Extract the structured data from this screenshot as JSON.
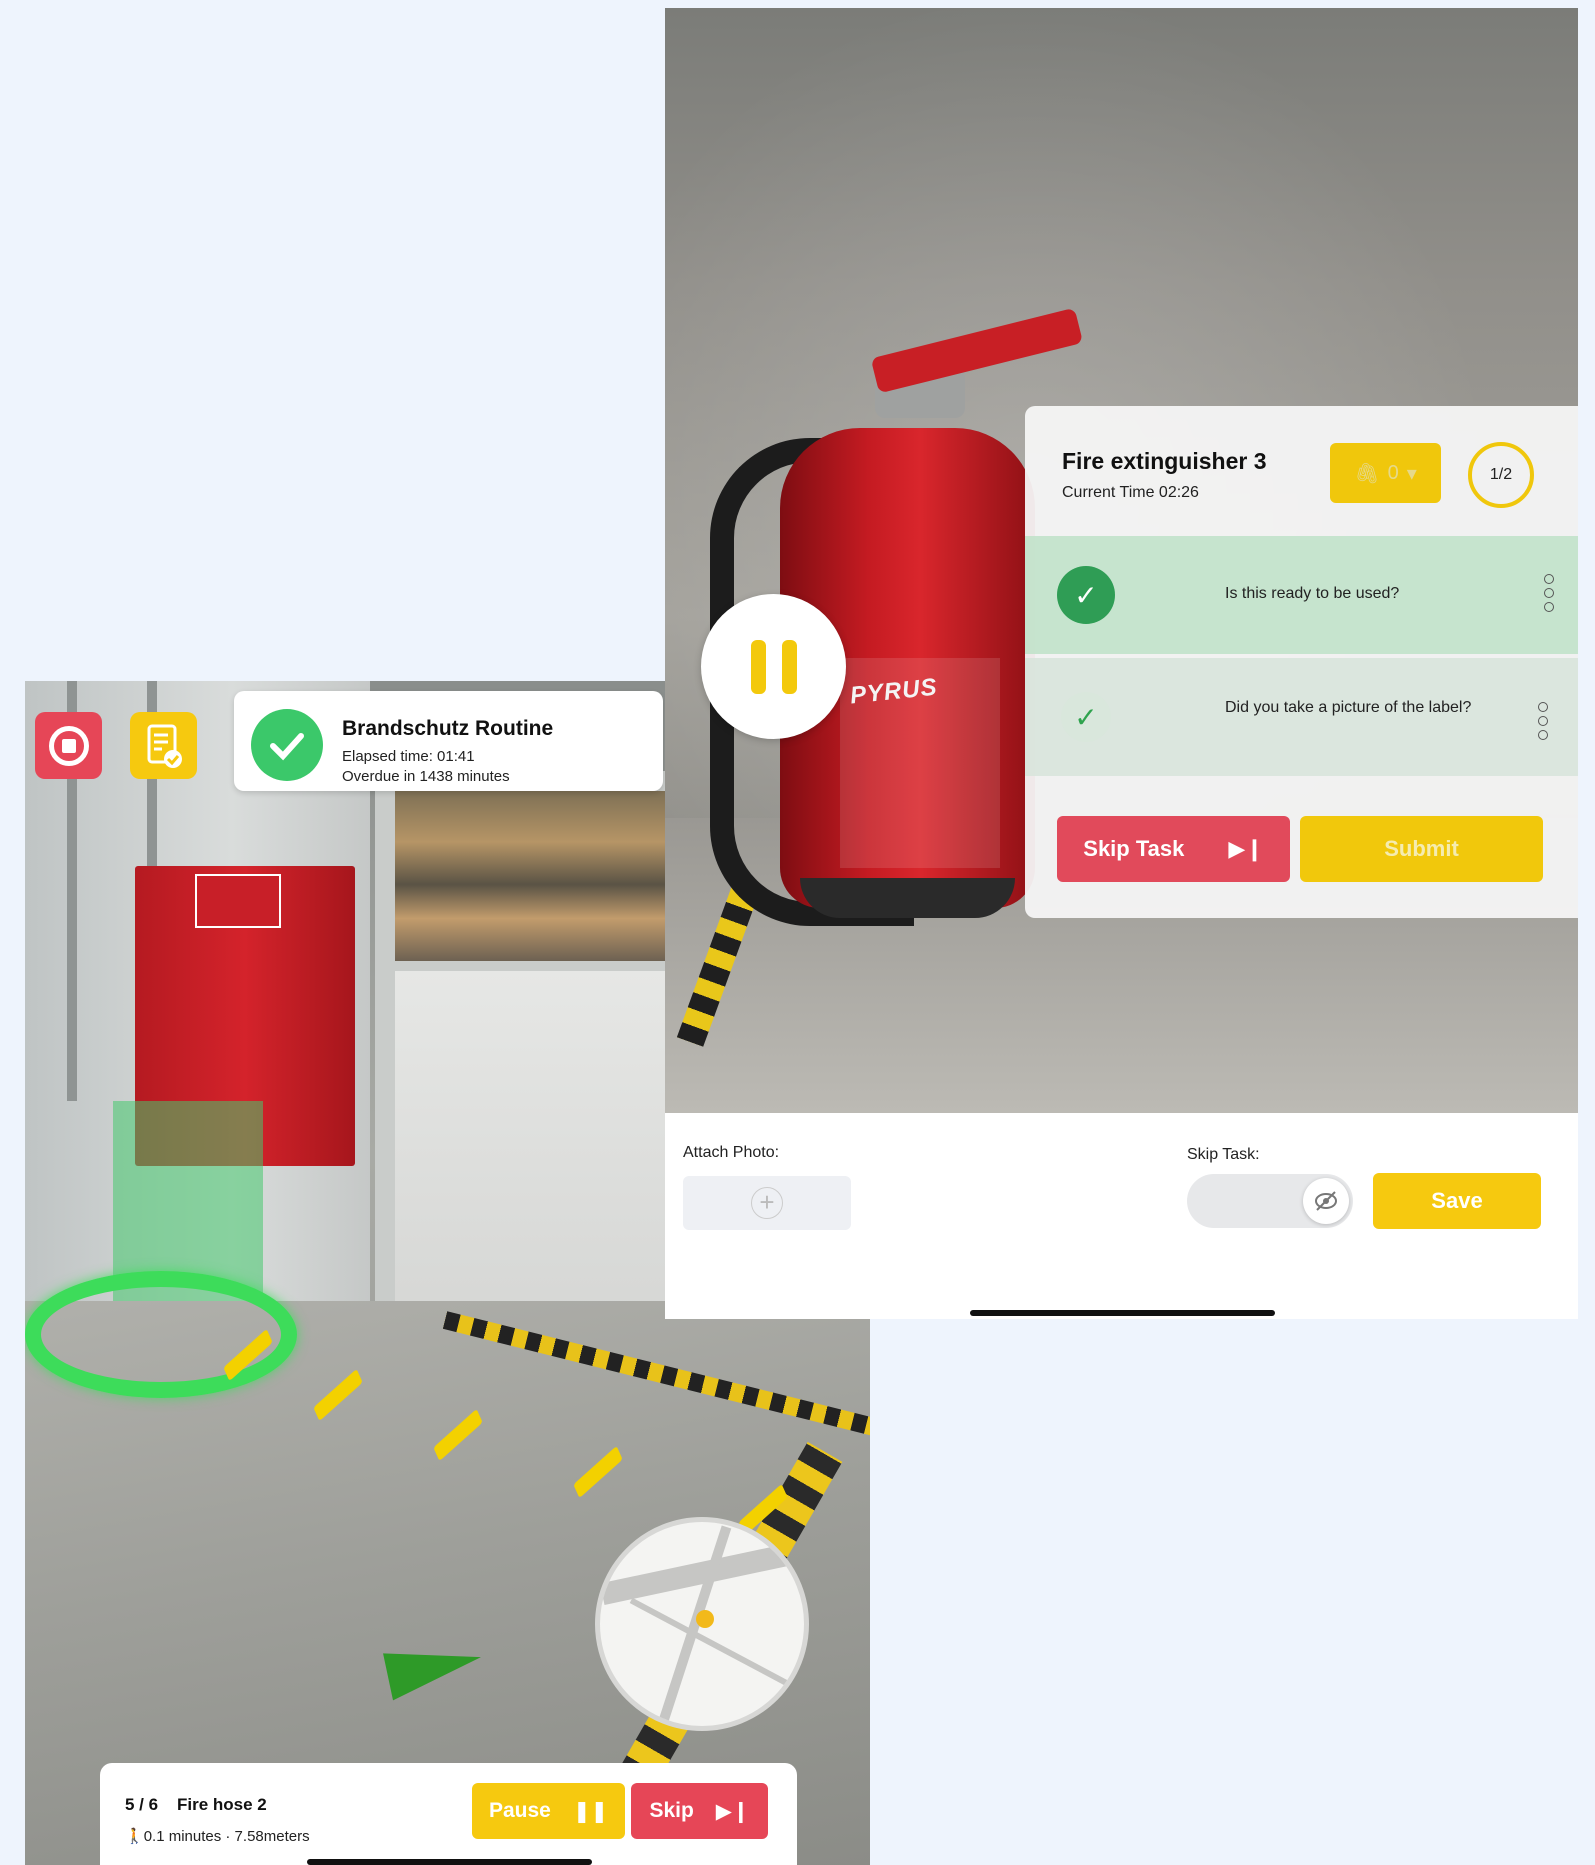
{
  "left_screen": {
    "route": {
      "title": "Brandschutz Routine",
      "elapsed": "Elapsed time: 01:41",
      "overdue": "Overdue in 1438 minutes"
    },
    "bottom_bar": {
      "step": "5 / 6",
      "task": "Fire hose 2",
      "distance": "0.1 minutes · 7.58meters",
      "pause_label": "Pause",
      "skip_label": "Skip"
    },
    "icons": [
      "stop-icon",
      "checklist-icon",
      "checkmark-icon",
      "walking-person-icon",
      "pause-icon",
      "skip-next-icon"
    ],
    "colors": {
      "accent_yellow": "#f6c90f",
      "danger_red": "#e64657",
      "success_green": "#3bc86a"
    }
  },
  "right_screen": {
    "task": {
      "title": "Fire extinguisher 3",
      "current_time": "Current Time 02:26",
      "attachments": "0",
      "progress": "1/2"
    },
    "questions": [
      {
        "text": "Is this ready to be used?",
        "status": "done"
      },
      {
        "text": "Did you take a picture of the label?",
        "status": "active"
      }
    ],
    "skip_task_label": "Skip Task",
    "submit_label": "Submit",
    "attach_photo_label": "Attach Photo:",
    "skip_task_toggle_label": "Skip Task:",
    "save_label": "Save",
    "extinguisher_brand": "PYRUS"
  }
}
